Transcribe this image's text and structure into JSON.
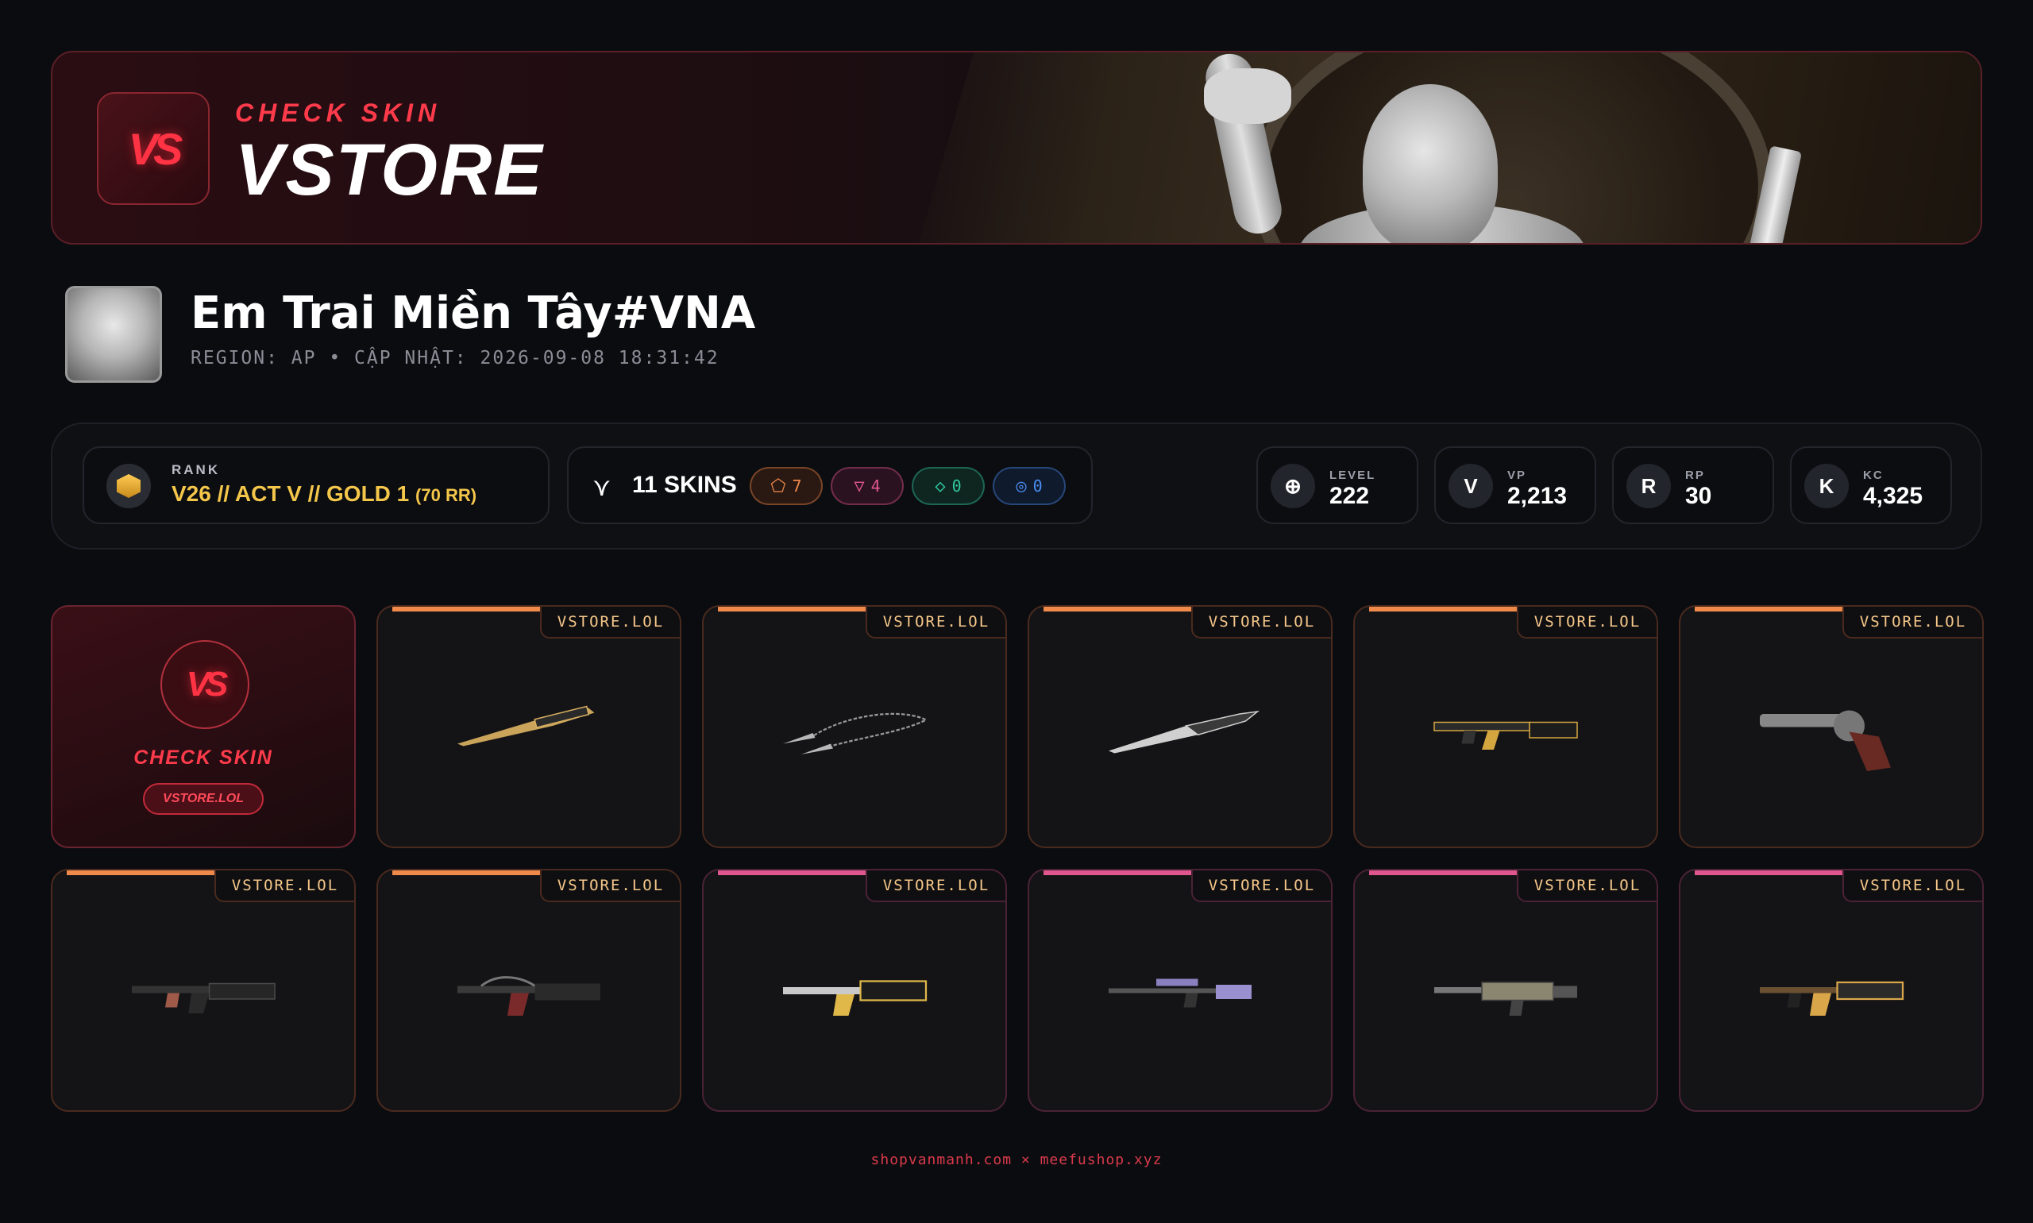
{
  "banner": {
    "subtitle": "CHECK SKIN",
    "brand": "VSTORE",
    "logo_mark": "VS"
  },
  "player": {
    "name": "Em Trai Miền Tây#VNA",
    "meta": "REGION: AP • CẬP NHẬT: 2026-09-08 18:31:42"
  },
  "rank": {
    "label": "RANK",
    "value": "V26 // ACT V // GOLD 1",
    "rr": "(70 RR)"
  },
  "skins": {
    "count_label": "11 SKINS",
    "tiers": [
      {
        "icon": "exclusive-tier-icon",
        "count": "7",
        "color": "#f08a4b"
      },
      {
        "icon": "premium-tier-icon",
        "count": "4",
        "color": "#e0578f"
      },
      {
        "icon": "deluxe-tier-icon",
        "count": "0",
        "color": "#2fc7a0"
      },
      {
        "icon": "select-tier-icon",
        "count": "0",
        "color": "#4a8cf0"
      }
    ]
  },
  "currencies": [
    {
      "label": "LEVEL",
      "value": "222",
      "icon": "level-icon",
      "glyph": "⊕"
    },
    {
      "label": "VP",
      "value": "2,213",
      "icon": "vp-icon",
      "glyph": "V"
    },
    {
      "label": "RP",
      "value": "30",
      "icon": "rp-icon",
      "glyph": "R"
    },
    {
      "label": "KC",
      "value": "4,325",
      "icon": "kc-icon",
      "glyph": "K"
    }
  ],
  "brand_card": {
    "title": "CHECK SKIN",
    "url": "VSTORE.LOL",
    "logo_mark": "VS"
  },
  "cards": [
    {
      "tag": "VSTORE.LOL",
      "tier": "orange",
      "item": "knife-1"
    },
    {
      "tag": "VSTORE.LOL",
      "tier": "orange",
      "item": "kunai-chain"
    },
    {
      "tag": "VSTORE.LOL",
      "tier": "orange",
      "item": "dagger"
    },
    {
      "tag": "VSTORE.LOL",
      "tier": "orange",
      "item": "rifle-gold"
    },
    {
      "tag": "VSTORE.LOL",
      "tier": "orange",
      "item": "revolver"
    },
    {
      "tag": "VSTORE.LOL",
      "tier": "orange",
      "item": "vandal-dark"
    },
    {
      "tag": "VSTORE.LOL",
      "tier": "orange",
      "item": "vandal-red"
    },
    {
      "tag": "VSTORE.LOL",
      "tier": "pink",
      "item": "rifle-gold-2"
    },
    {
      "tag": "VSTORE.LOL",
      "tier": "pink",
      "item": "sniper"
    },
    {
      "tag": "VSTORE.LOL",
      "tier": "pink",
      "item": "rifle-tan"
    },
    {
      "tag": "VSTORE.LOL",
      "tier": "pink",
      "item": "vandal-gold"
    }
  ],
  "footer": "shopvanmanh.com × meefushop.xyz"
}
